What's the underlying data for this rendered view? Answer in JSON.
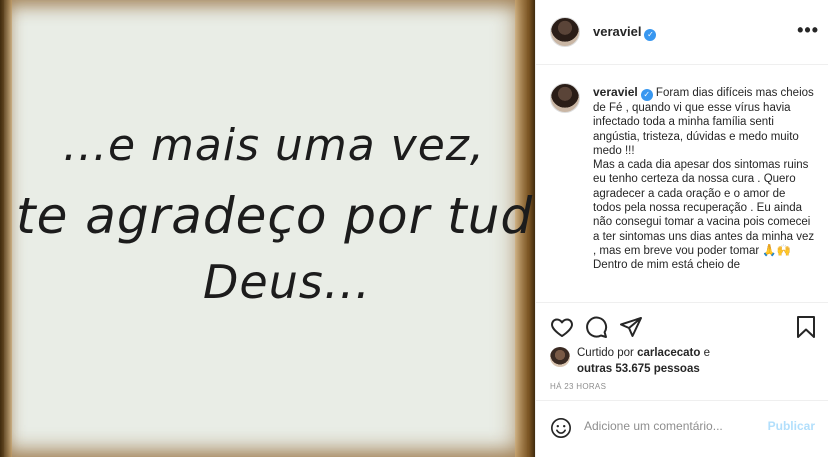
{
  "image": {
    "line1": "...e mais uma vez,",
    "line2": "te agradeço por tudo",
    "line3": "Deus..."
  },
  "header": {
    "username": "veraviel",
    "more": "•••"
  },
  "caption": {
    "username": "veraviel",
    "text": "Foram dias difíceis mas cheios de Fé , quando vi que esse vírus havia infectado toda a minha família senti angústia, tristeza, dúvidas e medo muito medo !!!\nMas a cada dia apesar dos sintomas ruins eu tenho certeza da nossa cura . Quero agradecer a cada oração e o amor de todos pela nossa recuperação . Eu ainda não consegui tomar a vacina pois comecei a ter sintomas uns dias antes da minha vez , mas em breve vou poder tomar 🙏🙌\nDentro de mim está cheio de"
  },
  "likes": {
    "prefix": "Curtido por",
    "user": "carlacecato",
    "mid": "e",
    "others": "outras 53.675 pessoas"
  },
  "time": "HÁ 23 HORAS",
  "comment": {
    "placeholder": "Adicione um comentário...",
    "publish": "Publicar"
  },
  "icons": [
    "heart-icon",
    "comment-icon",
    "share-icon",
    "bookmark-icon",
    "emoji-icon",
    "more-icon",
    "verified-icon"
  ]
}
